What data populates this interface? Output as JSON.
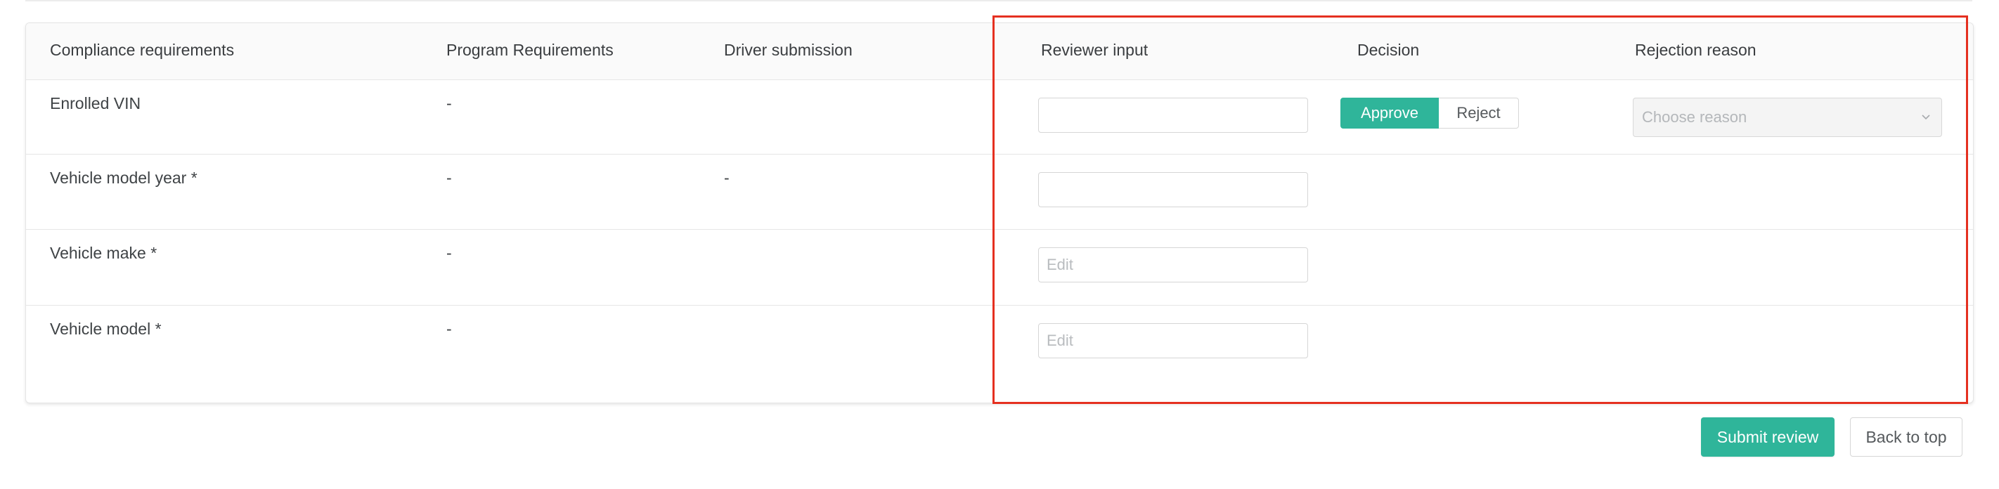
{
  "table": {
    "headers": {
      "compliance": "Compliance requirements",
      "program": "Program Requirements",
      "driver": "Driver submission",
      "reviewer": "Reviewer input",
      "decision": "Decision",
      "rejection": "Rejection reason"
    },
    "rows": [
      {
        "requirement": "Enrolled VIN",
        "program": "-",
        "driver": "",
        "reviewer_value": "",
        "reviewer_placeholder": "",
        "decision": {
          "approve": "Approve",
          "reject": "Reject",
          "selected": "Approve"
        },
        "rejection_placeholder": "Choose reason"
      },
      {
        "requirement": "Vehicle model year *",
        "program": "-",
        "driver": "-",
        "reviewer_value": "",
        "reviewer_placeholder": ""
      },
      {
        "requirement": "Vehicle make *",
        "program": "-",
        "driver": "",
        "reviewer_value": "",
        "reviewer_placeholder": "Edit"
      },
      {
        "requirement": "Vehicle model *",
        "program": "-",
        "driver": "",
        "reviewer_value": "",
        "reviewer_placeholder": "Edit"
      }
    ]
  },
  "actions": {
    "submit": "Submit review",
    "back": "Back to top"
  },
  "colors": {
    "accent": "#2fb59a",
    "highlight": "#e53020"
  },
  "icons": {
    "select_caret": "chevron-down-icon"
  }
}
